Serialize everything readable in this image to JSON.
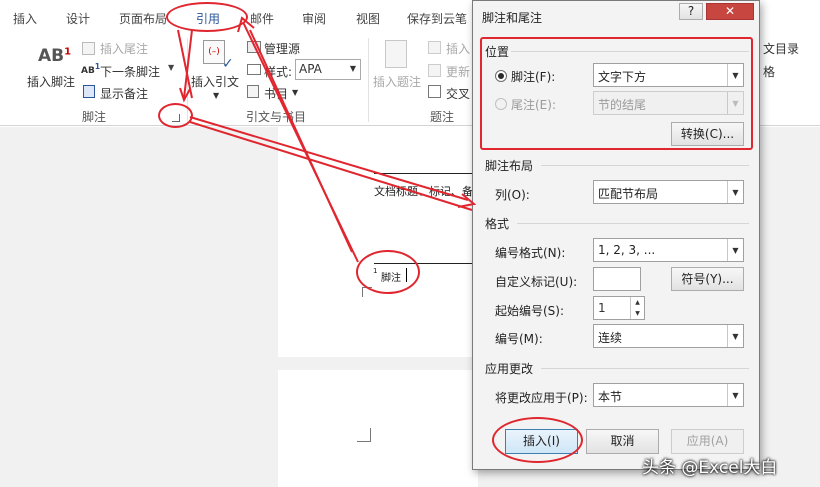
{
  "ribbon_tabs": {
    "insert": "插入",
    "design": "设计",
    "layout": "页面布局",
    "references": "引用",
    "mailings": "邮件",
    "review": "审阅",
    "view": "视图",
    "cloud": "保存到云笔"
  },
  "footnotes_group": {
    "insert_footnote": "插入脚注",
    "insert_endnote": "插入尾注",
    "next_footnote": "下一条脚注",
    "show_notes": "显示备注",
    "label": "脚注"
  },
  "citations_group": {
    "insert_citation": "插入引文",
    "manage_sources": "管理源",
    "style_label": "样式:",
    "style_value": "APA",
    "bibliography": "书目",
    "label": "引文与书目"
  },
  "captions_group": {
    "insert_caption": "插入题注",
    "insert_small": "插入",
    "update": "更新",
    "cross": "交叉",
    "label": "题注"
  },
  "right_group": {
    "toc": "文目录",
    "grid": "格"
  },
  "document": {
    "body_text": "文档标题、标记、备",
    "footnote_mark": "1",
    "footnote_text": "脚注"
  },
  "dialog": {
    "title": "脚注和尾注",
    "help": "?",
    "close": "✕",
    "location_section": "位置",
    "footnote_label": "脚注(F):",
    "footnote_value": "文字下方",
    "endnote_label": "尾注(E):",
    "endnote_value": "节的结尾",
    "convert_button": "转换(C)...",
    "layout_section": "脚注布局",
    "columns_label": "列(O):",
    "columns_value": "匹配节布局",
    "format_section": "格式",
    "number_format_label": "编号格式(N):",
    "number_format_value": "1, 2, 3, ...",
    "custom_mark_label": "自定义标记(U):",
    "custom_mark_value": "",
    "symbol_button": "符号(Y)...",
    "start_at_label": "起始编号(S):",
    "start_at_value": "1",
    "numbering_label": "编号(M):",
    "numbering_value": "连续",
    "apply_section": "应用更改",
    "apply_to_label": "将更改应用于(P):",
    "apply_to_value": "本节",
    "insert_button": "插入(I)",
    "cancel_button": "取消",
    "apply_button": "应用(A)"
  },
  "watermark": "头条 @Excel大白",
  "colors": {
    "annotation": "#e0262f",
    "ribbon_active": "#2b579a"
  }
}
